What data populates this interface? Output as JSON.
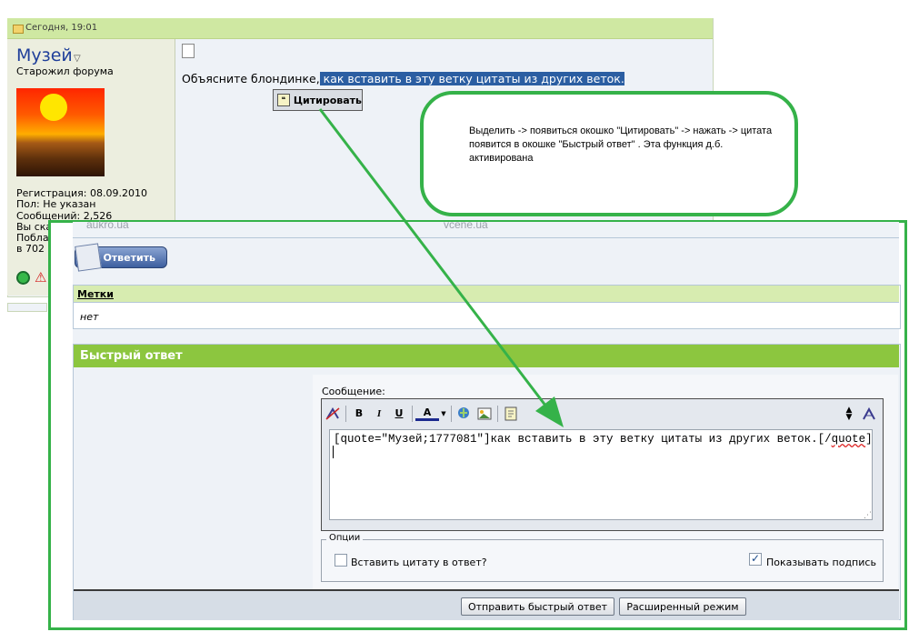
{
  "post": {
    "date": "Сегодня, 19:01",
    "username": "Музей",
    "user_title": "Старожил форума",
    "stats": [
      "Регистрация: 08.09.2010",
      "Пол: Не указан",
      "Сообщений: 2,526",
      "Вы ска",
      "Побла",
      "в 702"
    ],
    "message_prefix": "Объясните блондинке,",
    "message_selected": " как вставить в эту ветку цитаты из других веток.",
    "quote_popup_label": "Цитировать"
  },
  "callout": {
    "text": "Выделить -> появиться окошко \"Цитировать\" -> нажать -> цитата появится в окошке \"Быстрый ответ\" . Эта функция д.б. активирована"
  },
  "watermarks": [
    "aukro.ua",
    "vcene.ua"
  ],
  "reply_button": "Ответить",
  "tags": {
    "title": "Метки",
    "value": "нет"
  },
  "quick_reply": {
    "title": "Быстрый ответ",
    "message_label": "Сообщение:",
    "text_quote_open": "[quote",
    "text_mid": "=\"Музей;1777081\"]как вставить в эту ветку цитаты из других веток.[/",
    "text_quote_close": "quote",
    "text_end": "]",
    "toolbar": {
      "bold": "B",
      "italic": "I",
      "underline": "U",
      "font_color": "A"
    },
    "options_legend": "Опции",
    "option_insert_quote": "Вставить цитату в ответ?",
    "option_show_signature": "Показывать подпись",
    "submit_label": "Отправить быстрый ответ",
    "advanced_label": "Расширенный режим"
  },
  "colors": {
    "annotation": "#35b249",
    "header_green": "#8cc63f",
    "selection": "#2b5ea2"
  }
}
